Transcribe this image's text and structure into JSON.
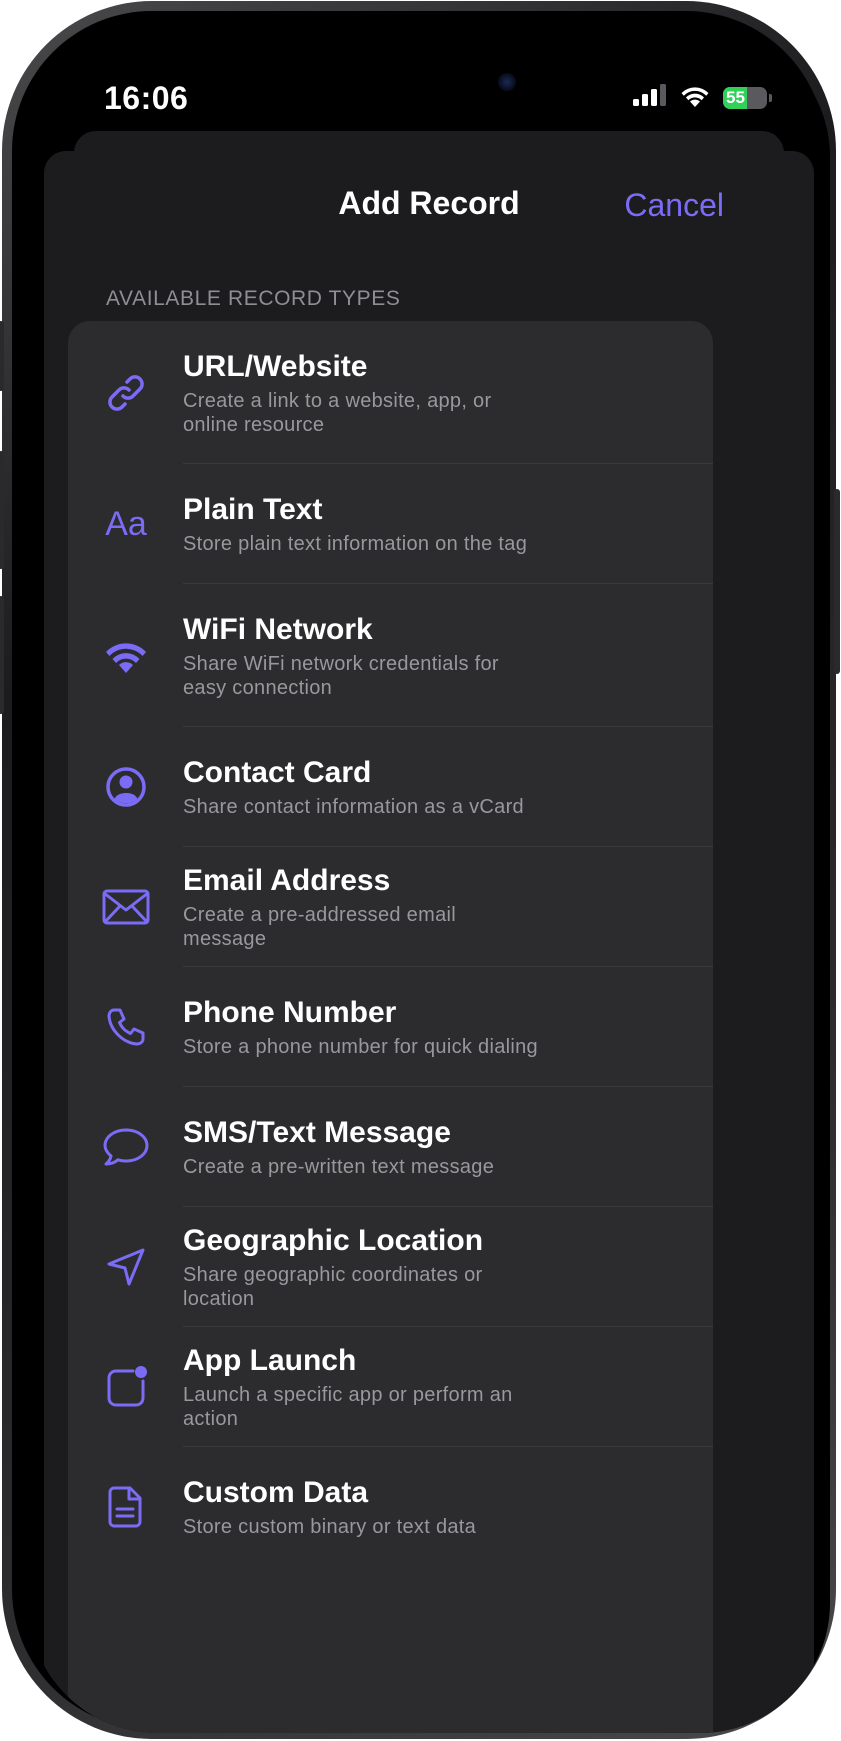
{
  "status_bar": {
    "time": "16:06",
    "battery_text": "55",
    "battery_level": 0.55,
    "colors": {
      "battery": "#30d158"
    }
  },
  "sheet": {
    "title": "Add Record",
    "cancel_label": "Cancel",
    "section_header": "AVAILABLE RECORD TYPES"
  },
  "accent_color": "#7b6cf6",
  "record_types": [
    {
      "icon": "link-icon",
      "title": "URL/Website",
      "description": "Create a link to a website, app, or online resource"
    },
    {
      "icon": "text-icon",
      "icon_text": "Aa",
      "title": "Plain Text",
      "description": "Store plain text information on the tag"
    },
    {
      "icon": "wifi-icon",
      "title": "WiFi Network",
      "description": "Share WiFi network credentials for easy connection"
    },
    {
      "icon": "contact-icon",
      "title": "Contact Card",
      "description": "Share contact information as a vCard"
    },
    {
      "icon": "envelope-icon",
      "title": "Email Address",
      "description": "Create a pre-addressed email message"
    },
    {
      "icon": "phone-icon",
      "title": "Phone Number",
      "description": "Store a phone number for quick dialing"
    },
    {
      "icon": "message-bubble-icon",
      "title": "SMS/Text Message",
      "description": "Create a pre-written text message"
    },
    {
      "icon": "location-arrow-icon",
      "title": "Geographic Location",
      "description": "Share geographic coordinates or location"
    },
    {
      "icon": "app-badge-icon",
      "title": "App Launch",
      "description": "Launch a specific app or perform an action"
    },
    {
      "icon": "document-icon",
      "title": "Custom Data",
      "description": "Store custom binary or text data"
    }
  ]
}
